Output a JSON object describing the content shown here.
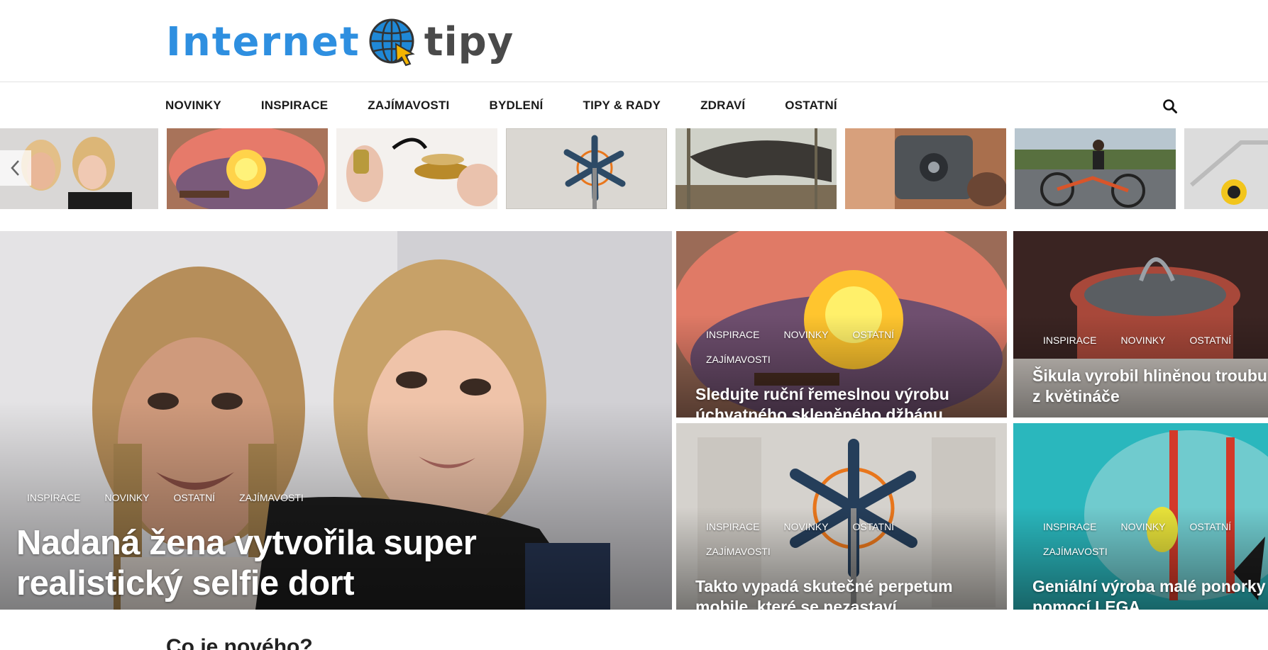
{
  "site": {
    "logo_word1": "Internet",
    "logo_word2": "tipy",
    "brand_blue": "#2e8fe0",
    "brand_gray": "#4a4a4a"
  },
  "nav": {
    "items": [
      "NOVINKY",
      "INSPIRACE",
      "ZAJÍMAVOSTI",
      "BYDLENÍ",
      "TIPY & RADY",
      "ZDRAVÍ",
      "OSTATNÍ"
    ],
    "search_icon": "search-icon"
  },
  "strip": {
    "prev_icon": "chevron-left-icon",
    "thumbs": [
      "selfie-cake",
      "glass-beads",
      "metal-insect",
      "wind-spinner",
      "rock-forest",
      "chainsaw-parts",
      "tricycle-rider",
      "cart-frame"
    ]
  },
  "featured": {
    "main": {
      "cats": [
        "INSPIRACE",
        "NOVINKY",
        "OSTATNÍ",
        "ZAJÍMAVOSTI"
      ],
      "title": "Nadaná žena vytvořila super realistický selfie dort"
    },
    "cards": [
      {
        "cats": [
          "INSPIRACE",
          "NOVINKY",
          "OSTATNÍ",
          "ZAJÍMAVOSTI"
        ],
        "title": "Sledujte ruční řemeslnou výrobu úchvatného skleněného džbánu"
      },
      {
        "cats": [
          "INSPIRACE",
          "NOVINKY",
          "OSTATNÍ"
        ],
        "title": "Šikula vyrobil hliněnou troubu z květináče"
      },
      {
        "cats": [
          "INSPIRACE",
          "NOVINKY",
          "OSTATNÍ",
          "ZAJÍMAVOSTI"
        ],
        "title": "Takto vypadá skutečné perpetum mobile, které se nezastaví"
      },
      {
        "cats": [
          "INSPIRACE",
          "NOVINKY",
          "OSTATNÍ",
          "ZAJÍMAVOSTI"
        ],
        "title": "Geniální výroba malé ponorky pomocí LEGA"
      }
    ]
  },
  "section": {
    "heading": "Co je nového?"
  }
}
